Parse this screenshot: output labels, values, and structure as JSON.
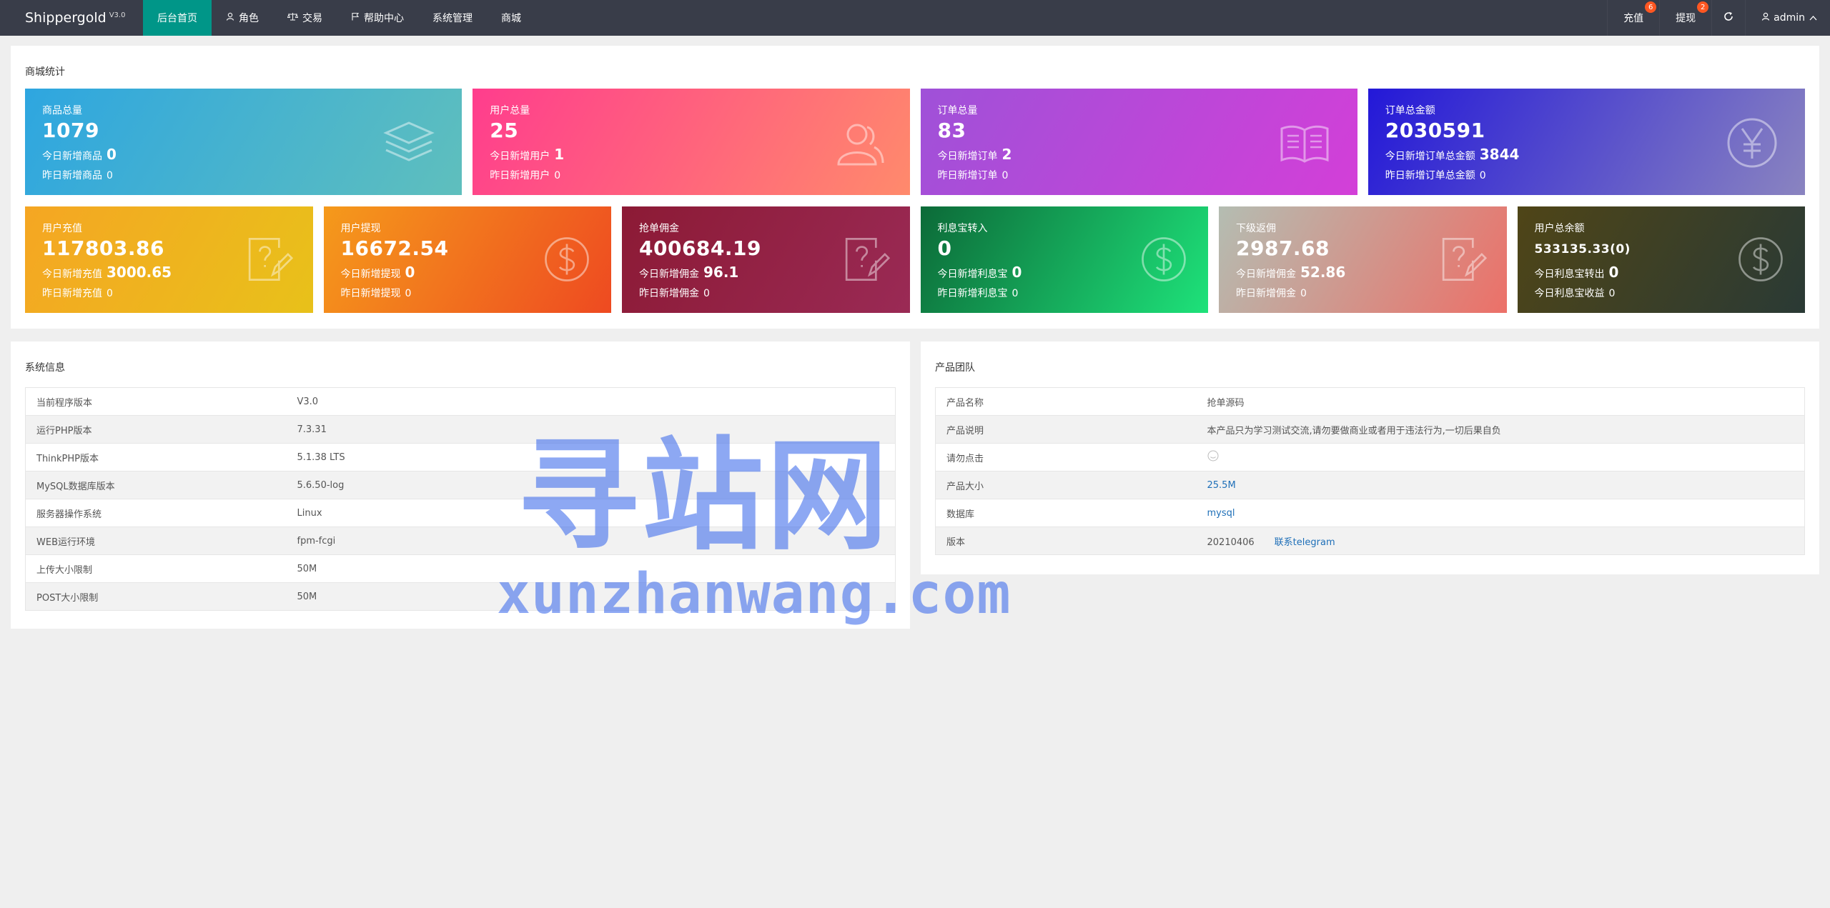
{
  "app": {
    "name": "Shippergold",
    "version": "V3.0"
  },
  "nav": [
    {
      "label": "后台首页",
      "icon": "none",
      "active": true
    },
    {
      "label": "角色",
      "icon": "user-icon"
    },
    {
      "label": "交易",
      "icon": "scale-icon"
    },
    {
      "label": "帮助中心",
      "icon": "flag-icon"
    },
    {
      "label": "系统管理",
      "icon": "none"
    },
    {
      "label": "商城",
      "icon": "none"
    }
  ],
  "right_nav": {
    "recharge": {
      "label": "充值",
      "badge": "6"
    },
    "withdraw": {
      "label": "提现",
      "badge": "2"
    },
    "refresh_icon": "refresh-icon",
    "user": "admin"
  },
  "stats": {
    "title": "商城统计",
    "row1": [
      {
        "label": "商品总量",
        "value": "1079",
        "today_label": "今日新增商品",
        "today": "0",
        "yest_label": "昨日新增商品",
        "yest": "0",
        "icon": "layers-icon",
        "colors": [
          "#2ea6e0",
          "#5fbfbd"
        ]
      },
      {
        "label": "用户总量",
        "value": "25",
        "today_label": "今日新增用户",
        "today": "1",
        "yest_label": "昨日新增用户",
        "yest": "0",
        "icon": "users-icon",
        "colors": [
          "#ff3d8d",
          "#ff8a6c"
        ]
      },
      {
        "label": "订单总量",
        "value": "83",
        "today_label": "今日新增订单",
        "today": "2",
        "yest_label": "昨日新增订单",
        "yest": "0",
        "icon": "book-icon",
        "colors": [
          "#9f51d8",
          "#d33fd8"
        ]
      },
      {
        "label": "订单总金额",
        "value": "2030591",
        "today_label": "今日新增订单总金额",
        "today": "3844",
        "yest_label": "昨日新增订单总金额",
        "yest": "0",
        "icon": "yen-icon",
        "colors": [
          "#2318d8",
          "#8a84c0"
        ]
      }
    ],
    "row2": [
      {
        "label": "用户充值",
        "value": "117803.86",
        "today_label": "今日新增充值",
        "today": "3000.65",
        "yest_label": "昨日新增充值",
        "yest": "0",
        "icon": "edit-doc-icon",
        "colors": [
          "#f5a623",
          "#e8c11a"
        ]
      },
      {
        "label": "用户提现",
        "value": "16672.54",
        "today_label": "今日新增提现",
        "today": "0",
        "yest_label": "昨日新增提现",
        "yest": "0",
        "icon": "dollar-icon",
        "colors": [
          "#f59a1b",
          "#ee4a21"
        ]
      },
      {
        "label": "抢单佣金",
        "value": "400684.19",
        "today_label": "今日新增佣金",
        "today": "96.1",
        "yest_label": "昨日新增佣金",
        "yest": "0",
        "icon": "edit-doc-icon",
        "colors": [
          "#8c1a35",
          "#9a2a55"
        ]
      },
      {
        "label": "利息宝转入",
        "value": "0",
        "today_label": "今日新增利息宝",
        "today": "0",
        "yest_label": "昨日新增利息宝",
        "yest": "0",
        "icon": "dollar-icon",
        "colors": [
          "#0c6a38",
          "#1ee27a"
        ]
      },
      {
        "label": "下级返佣",
        "value": "2987.68",
        "today_label": "今日新增佣金",
        "today": "52.86",
        "yest_label": "昨日新增佣金",
        "yest": "0",
        "icon": "edit-doc-icon",
        "colors": [
          "#b4bdb2",
          "#ec7068"
        ]
      },
      {
        "label": "用户总余额",
        "value": "533135.33(0)",
        "today_label": "今日利息宝转出",
        "today": "0",
        "yest_label": "今日利息宝收益",
        "yest": "0",
        "icon": "dollar-icon",
        "colors": [
          "#4f4517",
          "#2a3a35"
        ]
      }
    ]
  },
  "system": {
    "title": "系统信息",
    "rows": [
      {
        "k": "当前程序版本",
        "v": "V3.0"
      },
      {
        "k": "运行PHP版本",
        "v": "7.3.31"
      },
      {
        "k": "ThinkPHP版本",
        "v": "5.1.38 LTS"
      },
      {
        "k": "MySQL数据库版本",
        "v": "5.6.50-log"
      },
      {
        "k": "服务器操作系统",
        "v": "Linux"
      },
      {
        "k": "WEB运行环境",
        "v": "fpm-fcgi"
      },
      {
        "k": "上传大小限制",
        "v": "50M"
      },
      {
        "k": "POST大小限制",
        "v": "50M"
      }
    ]
  },
  "product": {
    "title": "产品团队",
    "rows": [
      {
        "k": "产品名称",
        "v": "抢单源码"
      },
      {
        "k": "产品说明",
        "v": "本产品只为学习测试交流,请勿要做商业或者用于违法行为,一切后果自负"
      },
      {
        "k": "请勿点击",
        "v": ""
      },
      {
        "k": "产品大小",
        "v": "25.5M"
      },
      {
        "k": "数据库",
        "v": "mysql"
      },
      {
        "k": "版本",
        "v": "20210406",
        "link": "联系telegram"
      }
    ]
  },
  "watermark": {
    "cn": "寻站网",
    "en": "xunzhanwang.com"
  }
}
